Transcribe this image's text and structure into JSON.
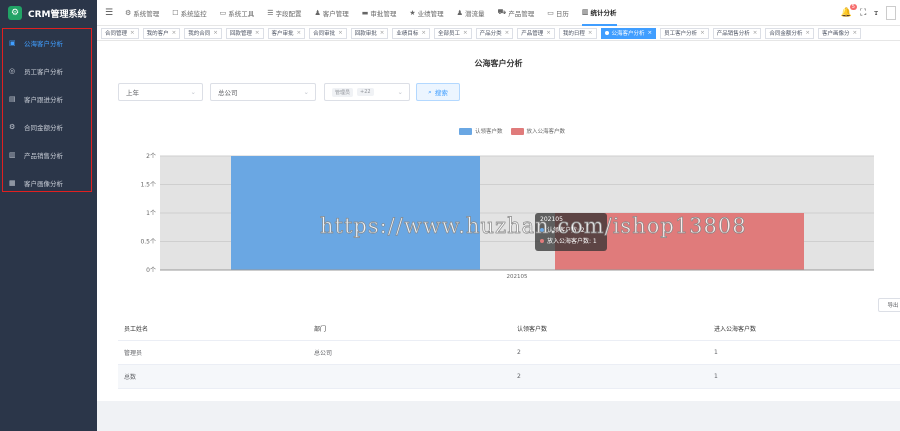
{
  "app": {
    "title": "CRM管理系统",
    "logo_icon": "⚙"
  },
  "sidebar": {
    "items": [
      {
        "label": "公海客户分析",
        "icon": "chart-icon",
        "glyph": "▣",
        "active": true
      },
      {
        "label": "员工客户分析",
        "icon": "dashboard-icon",
        "glyph": "◎",
        "active": false
      },
      {
        "label": "客户跟进分析",
        "icon": "document-icon",
        "glyph": "▤",
        "active": false
      },
      {
        "label": "合同金额分析",
        "icon": "gear-icon",
        "glyph": "⚙",
        "active": false
      },
      {
        "label": "产品销售分析",
        "icon": "bar-chart-icon",
        "glyph": "▥",
        "active": false
      },
      {
        "label": "客户画像分析",
        "icon": "grid-icon",
        "glyph": "▦",
        "active": false
      }
    ]
  },
  "topnav": {
    "items": [
      {
        "label": "系统管理",
        "glyph": "⚙"
      },
      {
        "label": "系统监控",
        "glyph": "☐"
      },
      {
        "label": "系统工具",
        "glyph": "▭"
      },
      {
        "label": "字段配置",
        "glyph": "☰"
      },
      {
        "label": "客户管理",
        "glyph": "♟"
      },
      {
        "label": "审批管理",
        "glyph": "▬"
      },
      {
        "label": "业绩管理",
        "glyph": "★"
      },
      {
        "label": "潜流量",
        "glyph": "♟"
      },
      {
        "label": "产品管理",
        "glyph": "⛟"
      },
      {
        "label": "日历",
        "glyph": "▭"
      },
      {
        "label": "统计分析",
        "glyph": "▥",
        "active": true
      }
    ],
    "notification_count": "5",
    "icons": {
      "bell": "🔔",
      "fullscreen": "⛶",
      "font_size": "ꭲ"
    }
  },
  "tabs": [
    {
      "label": "合同管理"
    },
    {
      "label": "我的客户"
    },
    {
      "label": "我的合同"
    },
    {
      "label": "回款管理"
    },
    {
      "label": "客户审批"
    },
    {
      "label": "合同审批"
    },
    {
      "label": "回款审批"
    },
    {
      "label": "业绩目标"
    },
    {
      "label": "全部员工"
    },
    {
      "label": "产品分类"
    },
    {
      "label": "产品管理"
    },
    {
      "label": "我的日程"
    },
    {
      "label": "公海客户分析",
      "active": true
    },
    {
      "label": "员工客户分析"
    },
    {
      "label": "产品销售分析"
    },
    {
      "label": "合同金额分析"
    },
    {
      "label": "客户画像分"
    }
  ],
  "page": {
    "title": "公海客户分析",
    "filters": {
      "period": "上年",
      "org": "总公司",
      "chip1": "管理员",
      "chip2": "+22",
      "search_label": "搜索",
      "search_icon": "search-icon"
    },
    "export_label": "导出"
  },
  "chart_data": {
    "type": "bar",
    "categories": [
      "202105"
    ],
    "series": [
      {
        "name": "认领客户数",
        "values": [
          2
        ],
        "color": "#6aa7e3"
      },
      {
        "name": "放入公海客户数",
        "values": [
          1
        ],
        "color": "#e07b7b"
      }
    ],
    "ylim": [
      0,
      2
    ],
    "yticks": [
      "0个",
      "0.5个",
      "1个",
      "1.5个",
      "2个"
    ],
    "grid": true,
    "legend": "top-center"
  },
  "tooltip": {
    "title": "202105",
    "row1": "认领客户数: 2",
    "row2": "放入公海客户数: 1"
  },
  "watermark": "https://www.huzhan.com/ishop13808",
  "table": {
    "headers": [
      "员工姓名",
      "部门",
      "认领客户数",
      "进入公海客户数"
    ],
    "rows": [
      [
        "管理员",
        "总公司",
        "2",
        "1"
      ],
      [
        "总数",
        "",
        "2",
        "1"
      ]
    ]
  }
}
